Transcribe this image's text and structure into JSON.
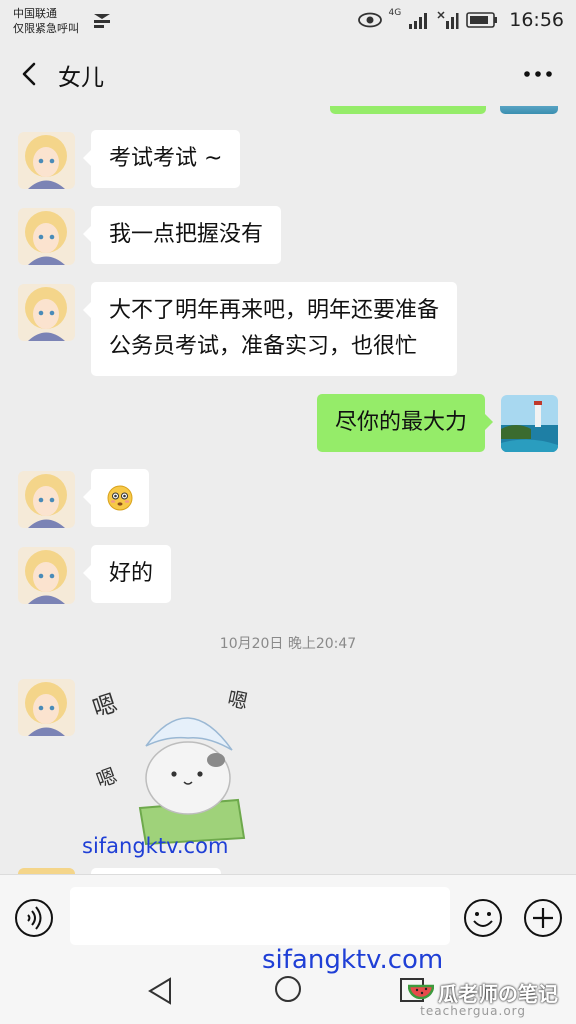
{
  "status_bar": {
    "carrier_line1": "中国联通",
    "carrier_line2": "仅限紧急呼叫",
    "network": "4G",
    "time": "16:56"
  },
  "header": {
    "title": "女儿",
    "back_icon": "chevron-left-icon",
    "more_icon": "more-dots-icon"
  },
  "messages": [
    {
      "side": "left",
      "text": "考试考试 ~"
    },
    {
      "side": "left",
      "text": "我一点把握没有"
    },
    {
      "side": "left",
      "text_line1": "大不了明年再来吧，明年还要准备",
      "text_line2": "公务员考试，准备实习，也很忙"
    },
    {
      "side": "right",
      "text": "尽你的最大力"
    },
    {
      "side": "left",
      "emoji": "😳"
    },
    {
      "side": "left",
      "text": "好的"
    },
    {
      "timestamp": "10月20日 晚上20:47"
    },
    {
      "side": "left",
      "sticker_text": "嗯"
    }
  ],
  "input_bar": {
    "voice_icon": "voice-icon",
    "emoji_icon": "emoji-icon",
    "plus_icon": "plus-icon",
    "placeholder": ""
  },
  "nav_bar": {
    "back_icon": "nav-back-icon",
    "home_icon": "nav-home-icon",
    "recent_icon": "nav-recent-icon"
  },
  "watermarks": {
    "site1": "sifangktv.com",
    "site2": "sifangktv.com",
    "brand": "瓜老师の笔记",
    "domain": "teachergua.org"
  },
  "colors": {
    "background": "#ededed",
    "outgoing_bubble": "#95ec69",
    "incoming_bubble": "#ffffff"
  }
}
